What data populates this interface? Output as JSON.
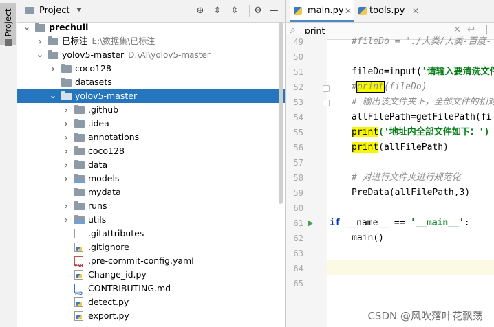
{
  "sidebar": {
    "tab_label": "Project"
  },
  "project_panel": {
    "title": "Project",
    "tree": [
      {
        "label": "prechuli",
        "type": "root",
        "indent": 0,
        "expanded": true,
        "bold": true
      },
      {
        "label": "已标注",
        "path": "E:\\数据集\\已标注",
        "type": "folder",
        "indent": 1,
        "expanded": false
      },
      {
        "label": "yolov5-master",
        "path": "D:\\AI\\yolov5-master",
        "type": "folder",
        "indent": 1,
        "expanded": true
      },
      {
        "label": "coco128",
        "type": "folder",
        "indent": 2,
        "expanded": false
      },
      {
        "label": "datasets",
        "type": "folder",
        "indent": 2,
        "leaf": true
      },
      {
        "label": "yolov5-master",
        "type": "folder",
        "indent": 2,
        "expanded": true,
        "selected": true
      },
      {
        "label": ".github",
        "type": "folder",
        "indent": 3,
        "expanded": false
      },
      {
        "label": ".idea",
        "type": "folder",
        "indent": 3,
        "expanded": false
      },
      {
        "label": "annotations",
        "type": "folder",
        "indent": 3,
        "expanded": false
      },
      {
        "label": "coco128",
        "type": "folder",
        "indent": 3,
        "expanded": false
      },
      {
        "label": "data",
        "type": "folder",
        "indent": 3,
        "expanded": false
      },
      {
        "label": "models",
        "type": "folder-mod",
        "indent": 3,
        "expanded": false
      },
      {
        "label": "mydata",
        "type": "folder",
        "indent": 3,
        "leaf": true
      },
      {
        "label": "runs",
        "type": "folder",
        "indent": 3,
        "expanded": false
      },
      {
        "label": "utils",
        "type": "folder-mod",
        "indent": 3,
        "expanded": false
      },
      {
        "label": ".gitattributes",
        "type": "file",
        "indent": 3
      },
      {
        "label": ".gitignore",
        "type": "file-py",
        "indent": 3
      },
      {
        "label": ".pre-commit-config.yaml",
        "type": "file-yml",
        "indent": 3
      },
      {
        "label": "Change_id.py",
        "type": "file-py",
        "indent": 3
      },
      {
        "label": "CONTRIBUTING.md",
        "type": "file-md",
        "indent": 3
      },
      {
        "label": "detect.py",
        "type": "file-py",
        "indent": 3
      },
      {
        "label": "export.py",
        "type": "file-py",
        "indent": 3
      }
    ]
  },
  "editor": {
    "tabs": [
      {
        "label": "main.py",
        "active": true
      },
      {
        "label": "tools.py",
        "active": false
      }
    ],
    "search": {
      "value": "print"
    },
    "line_numbers": [
      "49",
      "50",
      "51",
      "52",
      "53",
      "54",
      "55",
      "56",
      "57",
      "58",
      "59",
      "60",
      "61",
      "62",
      "63",
      "64",
      "65"
    ],
    "code": {
      "l49": "#fileDo = './人类/人类-百度-",
      "l50_a": "fileDo=input(",
      "l50_b": "'请输入要清洗文件",
      "l51_a": "#",
      "l51_b": "print",
      "l51_c": "(fileDo)",
      "l52": "# 输出该文件夹下，全部文件的相对",
      "l53": "allFilePath=getFilePath(fi",
      "l54_a": "print",
      "l54_b": "('地址内全部文件如下：')",
      "l55_a": "print",
      "l55_b": "(allFilePath)",
      "l57": "# 对进行文件夹进行规范化",
      "l58": "PreData(allFilePath,3)",
      "l60_a": "if",
      "l60_b": " __name__ == ",
      "l60_c": "'__main__'",
      "l60_d": ":",
      "l61": "main()"
    }
  },
  "watermark": "CSDN @风吹落叶花飘荡"
}
